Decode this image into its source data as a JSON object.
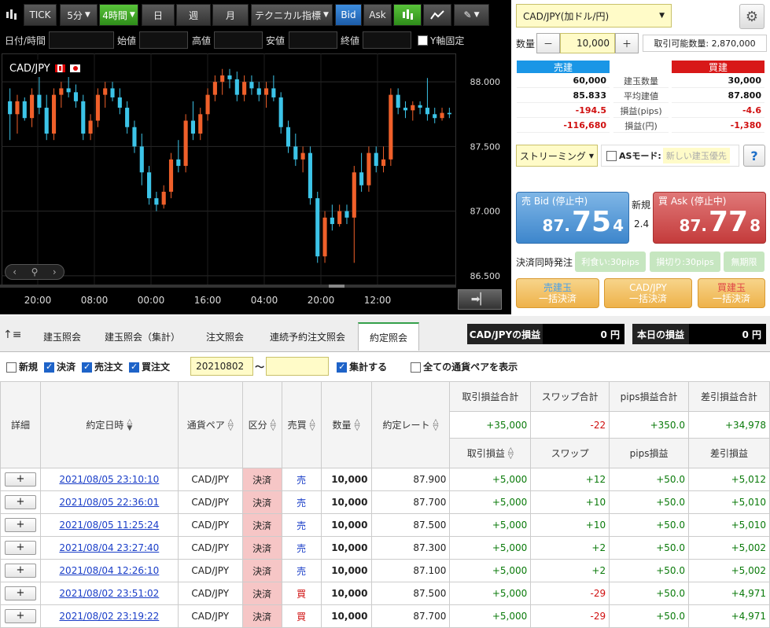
{
  "toolbar": {
    "tick": "TICK",
    "interval": "5分",
    "active_interval": "4時間",
    "day": "日",
    "week": "週",
    "month": "月",
    "technical": "テクニカル指標",
    "bid": "Bid",
    "ask": "Ask"
  },
  "ohlc_bar": {
    "datetime": "日付/時間",
    "open": "始値",
    "high": "高値",
    "low": "安値",
    "close": "終値",
    "y_fix": "Y軸固定"
  },
  "chart": {
    "symbol": "CAD/JPY",
    "y_ticks": [
      "88.000",
      "87.500",
      "87.000",
      "86.500"
    ],
    "x_ticks": [
      "20:00",
      "08:00",
      "00:00",
      "16:00",
      "04:00",
      "20:00",
      "12:00"
    ],
    "up_color": "#f0602a",
    "down_color": "#3cc4e8"
  },
  "chart_data": {
    "type": "candlestick",
    "title": "CAD/JPY",
    "ylim": [
      86.42,
      88.22
    ],
    "y_ticks": [
      88.0,
      87.5,
      87.0,
      86.5
    ],
    "candles": [
      {
        "o": 87.85,
        "h": 87.95,
        "l": 87.55,
        "c": 87.75
      },
      {
        "o": 87.75,
        "h": 87.9,
        "l": 87.6,
        "c": 87.85
      },
      {
        "o": 87.85,
        "h": 87.88,
        "l": 87.7,
        "c": 87.72
      },
      {
        "o": 87.72,
        "h": 87.95,
        "l": 87.65,
        "c": 87.9
      },
      {
        "o": 87.9,
        "h": 88.05,
        "l": 87.75,
        "c": 87.8
      },
      {
        "o": 87.8,
        "h": 87.9,
        "l": 87.55,
        "c": 87.6
      },
      {
        "o": 87.6,
        "h": 87.95,
        "l": 87.55,
        "c": 87.9
      },
      {
        "o": 87.9,
        "h": 88.0,
        "l": 87.8,
        "c": 87.95
      },
      {
        "o": 87.95,
        "h": 88.05,
        "l": 87.88,
        "c": 87.92
      },
      {
        "o": 87.92,
        "h": 87.98,
        "l": 87.8,
        "c": 87.85
      },
      {
        "o": 87.85,
        "h": 87.9,
        "l": 87.55,
        "c": 87.6
      },
      {
        "o": 87.6,
        "h": 87.75,
        "l": 87.55,
        "c": 87.7
      },
      {
        "o": 87.7,
        "h": 87.95,
        "l": 87.65,
        "c": 87.9
      },
      {
        "o": 87.9,
        "h": 88.0,
        "l": 87.8,
        "c": 87.95
      },
      {
        "o": 87.95,
        "h": 88.0,
        "l": 87.85,
        "c": 87.88
      },
      {
        "o": 87.88,
        "h": 87.95,
        "l": 87.75,
        "c": 87.8
      },
      {
        "o": 87.8,
        "h": 87.85,
        "l": 87.6,
        "c": 87.65
      },
      {
        "o": 87.65,
        "h": 87.7,
        "l": 87.45,
        "c": 87.5
      },
      {
        "o": 87.5,
        "h": 87.6,
        "l": 87.2,
        "c": 87.3
      },
      {
        "o": 87.3,
        "h": 87.35,
        "l": 87.05,
        "c": 87.1
      },
      {
        "o": 87.1,
        "h": 87.15,
        "l": 87.0,
        "c": 87.05
      },
      {
        "o": 87.05,
        "h": 87.2,
        "l": 87.02,
        "c": 87.15
      },
      {
        "o": 87.15,
        "h": 87.45,
        "l": 87.1,
        "c": 87.4
      },
      {
        "o": 87.4,
        "h": 87.55,
        "l": 87.3,
        "c": 87.35
      },
      {
        "o": 87.35,
        "h": 87.75,
        "l": 87.3,
        "c": 87.7
      },
      {
        "o": 87.7,
        "h": 87.85,
        "l": 87.55,
        "c": 87.6
      },
      {
        "o": 87.6,
        "h": 87.8,
        "l": 87.55,
        "c": 87.75
      },
      {
        "o": 87.75,
        "h": 87.95,
        "l": 87.7,
        "c": 87.9
      },
      {
        "o": 87.9,
        "h": 88.05,
        "l": 87.85,
        "c": 88.0
      },
      {
        "o": 88.0,
        "h": 88.1,
        "l": 87.9,
        "c": 88.05
      },
      {
        "o": 88.05,
        "h": 88.1,
        "l": 87.95,
        "c": 88.02
      },
      {
        "o": 88.02,
        "h": 88.08,
        "l": 87.85,
        "c": 87.9
      },
      {
        "o": 87.9,
        "h": 88.05,
        "l": 87.85,
        "c": 88.0
      },
      {
        "o": 88.0,
        "h": 88.05,
        "l": 87.9,
        "c": 87.95
      },
      {
        "o": 87.95,
        "h": 88.0,
        "l": 87.85,
        "c": 87.9
      },
      {
        "o": 87.9,
        "h": 88.0,
        "l": 87.8,
        "c": 87.95
      },
      {
        "o": 87.95,
        "h": 88.05,
        "l": 87.85,
        "c": 87.88
      },
      {
        "o": 87.88,
        "h": 87.92,
        "l": 87.6,
        "c": 87.65
      },
      {
        "o": 87.65,
        "h": 87.7,
        "l": 87.45,
        "c": 87.5
      },
      {
        "o": 87.5,
        "h": 87.6,
        "l": 87.35,
        "c": 87.4
      },
      {
        "o": 87.4,
        "h": 87.5,
        "l": 87.3,
        "c": 87.45
      },
      {
        "o": 87.45,
        "h": 87.5,
        "l": 87.05,
        "c": 87.1
      },
      {
        "o": 87.1,
        "h": 87.15,
        "l": 86.6,
        "c": 86.65
      },
      {
        "o": 86.65,
        "h": 87.0,
        "l": 86.6,
        "c": 86.95
      },
      {
        "o": 86.95,
        "h": 87.05,
        "l": 86.85,
        "c": 86.9
      },
      {
        "o": 86.9,
        "h": 87.05,
        "l": 86.88,
        "c": 87.0
      },
      {
        "o": 87.0,
        "h": 87.05,
        "l": 86.9,
        "c": 86.95
      },
      {
        "o": 86.95,
        "h": 87.35,
        "l": 86.6,
        "c": 87.3
      },
      {
        "o": 87.3,
        "h": 87.45,
        "l": 87.15,
        "c": 87.2
      },
      {
        "o": 87.2,
        "h": 87.5,
        "l": 87.15,
        "c": 87.45
      },
      {
        "o": 87.45,
        "h": 87.5,
        "l": 87.3,
        "c": 87.35
      },
      {
        "o": 87.35,
        "h": 87.5,
        "l": 87.3,
        "c": 87.4
      },
      {
        "o": 87.4,
        "h": 87.95,
        "l": 87.35,
        "c": 87.9
      },
      {
        "o": 87.9,
        "h": 87.95,
        "l": 87.75,
        "c": 87.8
      },
      {
        "o": 87.8,
        "h": 87.85,
        "l": 87.72,
        "c": 87.78
      },
      {
        "o": 87.78,
        "h": 87.85,
        "l": 87.7,
        "c": 87.82
      },
      {
        "o": 87.82,
        "h": 87.85,
        "l": 87.75,
        "c": 87.8
      },
      {
        "o": 87.8,
        "h": 88.03,
        "l": 87.7,
        "c": 87.75
      },
      {
        "o": 87.75,
        "h": 87.8,
        "l": 87.68,
        "c": 87.72
      },
      {
        "o": 87.72,
        "h": 87.8,
        "l": 87.7,
        "c": 87.76
      },
      {
        "o": 87.76,
        "h": 87.8,
        "l": 87.72,
        "c": 87.75
      }
    ]
  },
  "trade": {
    "pair": "CAD/JPY(加ドル/円)",
    "qty_label": "数量",
    "minus": "－",
    "qty": "10,000",
    "plus": "＋",
    "available": "取引可能数量: 2,870,000",
    "sell_header": "売建",
    "buy_header": "買建",
    "rows": [
      {
        "sell": "60,000",
        "label": "建玉数量",
        "buy": "30,000",
        "sell_color": "#111",
        "buy_color": "#111"
      },
      {
        "sell": "85.833",
        "label": "平均建値",
        "buy": "87.800",
        "sell_color": "#111",
        "buy_color": "#111"
      },
      {
        "sell": "-194.5",
        "label": "損益(pips)",
        "buy": "-4.6",
        "sell_color": "#d01010",
        "buy_color": "#d01010"
      },
      {
        "sell": "-116,680",
        "label": "損益(円)",
        "buy": "-1,380",
        "sell_color": "#d01010",
        "buy_color": "#d01010"
      }
    ],
    "streaming": "ストリーミング",
    "as_mode": "ASモード:",
    "as_placeholder": "新しい建玉優先",
    "help": "?",
    "sell_bid_label": "売 Bid (停止中)",
    "sell_small": "87.",
    "sell_big": "75",
    "sell_tail": "4",
    "spread_label": "新規",
    "spread": "2.4",
    "buy_ask_label": "買 Ask (停止中)",
    "buy_small": "87.",
    "buy_big": "77",
    "buy_tail": "8",
    "settle_label": "決済同時発注",
    "take_profit": "利食い:30pips",
    "stop_loss": "損切り:30pips",
    "no_limit": "無期限",
    "bulk_sell_1": "売建玉",
    "bulk_sell_2": "一括決済",
    "bulk_pair_1": "CAD/JPY",
    "bulk_pair_2": "一括決済",
    "bulk_buy_1": "買建玉",
    "bulk_buy_2": "一括決済"
  },
  "tabs": [
    "建玉照会",
    "建玉照会（集計）",
    "注文照会",
    "連続予約注文照会",
    "約定照会"
  ],
  "summary": {
    "pair_pl_label": "CAD/JPYの損益",
    "pair_pl_value": "0 円",
    "today_pl_label": "本日の損益",
    "today_pl_value": "0 円"
  },
  "filters": {
    "new": "新規",
    "settle": "決済",
    "sell": "売注文",
    "buy": "買注文",
    "date_from": "20210802",
    "tilde": "～",
    "date_to": "",
    "aggregate": "集計する",
    "all_pairs": "全ての通貨ペアを表示"
  },
  "table": {
    "headers": {
      "detail": "詳細",
      "date": "約定日時",
      "pair": "通貨ペア",
      "kubun": "区分",
      "side": "売買",
      "qty": "数量",
      "rate": "約定レート",
      "pl_total": "取引損益合計",
      "swap_total": "スワップ合計",
      "pips_total": "pips損益合計",
      "net_total": "差引損益合計",
      "pl": "取引損益",
      "swap": "スワップ",
      "pips": "pips損益",
      "net": "差引損益"
    },
    "totals": {
      "pl": "+35,000",
      "swap": "-22",
      "pips": "+350.0",
      "net": "+34,978"
    },
    "rows": [
      {
        "date": "2021/08/05 23:10:10",
        "pair": "CAD/JPY",
        "kubun": "決済",
        "side": "売",
        "qty": "10,000",
        "rate": "87.900",
        "pl": "+5,000",
        "swap": "+12",
        "pips": "+50.0",
        "net": "+5,012",
        "detail": "+"
      },
      {
        "date": "2021/08/05 22:36:01",
        "pair": "CAD/JPY",
        "kubun": "決済",
        "side": "売",
        "qty": "10,000",
        "rate": "87.700",
        "pl": "+5,000",
        "swap": "+10",
        "pips": "+50.0",
        "net": "+5,010",
        "detail": "+"
      },
      {
        "date": "2021/08/05 11:25:24",
        "pair": "CAD/JPY",
        "kubun": "決済",
        "side": "売",
        "qty": "10,000",
        "rate": "87.500",
        "pl": "+5,000",
        "swap": "+10",
        "pips": "+50.0",
        "net": "+5,010",
        "detail": "+"
      },
      {
        "date": "2021/08/04 23:27:40",
        "pair": "CAD/JPY",
        "kubun": "決済",
        "side": "売",
        "qty": "10,000",
        "rate": "87.300",
        "pl": "+5,000",
        "swap": "+2",
        "pips": "+50.0",
        "net": "+5,002",
        "detail": "+"
      },
      {
        "date": "2021/08/04 12:26:10",
        "pair": "CAD/JPY",
        "kubun": "決済",
        "side": "売",
        "qty": "10,000",
        "rate": "87.100",
        "pl": "+5,000",
        "swap": "+2",
        "pips": "+50.0",
        "net": "+5,002",
        "detail": "+"
      },
      {
        "date": "2021/08/02 23:51:02",
        "pair": "CAD/JPY",
        "kubun": "決済",
        "side": "買",
        "qty": "10,000",
        "rate": "87.500",
        "pl": "+5,000",
        "swap": "-29",
        "pips": "+50.0",
        "net": "+4,971",
        "detail": "+"
      },
      {
        "date": "2021/08/02 23:19:22",
        "pair": "CAD/JPY",
        "kubun": "決済",
        "side": "買",
        "qty": "10,000",
        "rate": "87.700",
        "pl": "+5,000",
        "swap": "-29",
        "pips": "+50.0",
        "net": "+4,971",
        "detail": "+"
      }
    ]
  }
}
